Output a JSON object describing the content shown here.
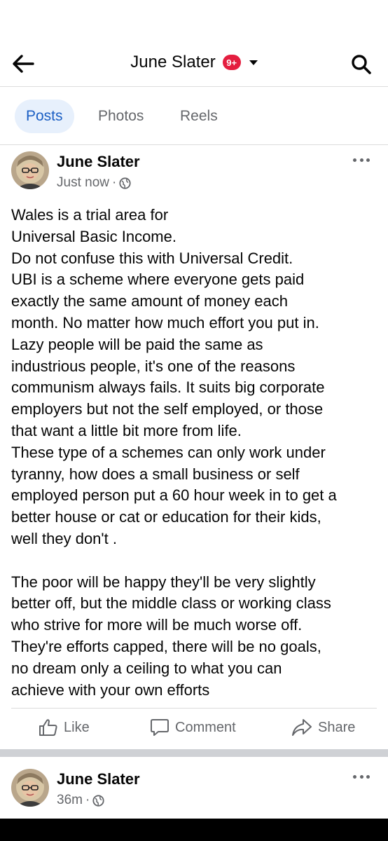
{
  "header": {
    "title": "June Slater",
    "badge": "9+",
    "back_icon": "arrow-left-icon",
    "search_icon": "search-icon"
  },
  "tabs": [
    {
      "label": "Posts",
      "active": true
    },
    {
      "label": "Photos",
      "active": false
    },
    {
      "label": "Reels",
      "active": false
    }
  ],
  "posts": [
    {
      "author": "June Slater",
      "time": "Just now",
      "separator": "·",
      "privacy_icon": "globe-icon",
      "text": "Wales is a trial area for\nUniversal Basic Income.\nDo not confuse this with Universal Credit.\nUBI is a scheme where everyone gets paid\nexactly the same amount of money each\nmonth. No matter how much effort you put in.\nLazy people will be paid the same as\nindustrious people, it's one of the reasons\ncommunism always fails. It suits big corporate\nemployers but not the self employed, or those\nthat want a little bit more from life.\nThese type of a schemes can only work under\ntyranny, how does a small business or self\nemployed person put a 60 hour week in to get a\nbetter house or cat or education for their kids,\nwell they don't .\n\nThe poor will be happy they'll be very slightly\nbetter off, but the middle class or working class\nwho strive for more will be much worse off.\nThey're efforts capped, there will be no goals,\nno dream only a ceiling to what you can\nachieve with your own efforts",
      "actions": {
        "like": "Like",
        "comment": "Comment",
        "share": "Share"
      }
    },
    {
      "author": "June Slater",
      "time": "36m",
      "separator": "·",
      "privacy_icon": "globe-icon"
    }
  ],
  "colors": {
    "accent": "#1b5fc4",
    "active_tab_bg": "#e7f0fc",
    "badge": "#e41e3f",
    "secondary_text": "#65676b"
  }
}
